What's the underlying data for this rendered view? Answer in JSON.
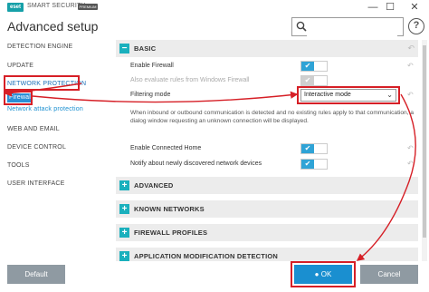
{
  "window": {
    "logo_text": "eset",
    "app_name": "SMART SECURITY",
    "app_badge": "PREMIUM",
    "minimize_glyph": "—",
    "maximize_glyph": "☐",
    "close_glyph": "✕"
  },
  "header": {
    "title": "Advanced setup",
    "search_placeholder": "",
    "help_glyph": "?"
  },
  "sidebar": {
    "items": [
      {
        "label": "DETECTION ENGINE"
      },
      {
        "label": "UPDATE"
      },
      {
        "label": "NETWORK PROTECTION"
      },
      {
        "label": "Firewall"
      },
      {
        "label": "Network attack protection"
      },
      {
        "label": "WEB AND EMAIL"
      },
      {
        "label": "DEVICE CONTROL"
      },
      {
        "label": "TOOLS"
      },
      {
        "label": "USER INTERFACE"
      }
    ]
  },
  "basic": {
    "title": "BASIC",
    "toggle_glyph": "−",
    "enable_firewall": "Enable Firewall",
    "evaluate_windows": "Also evaluate rules from Windows Firewall",
    "filtering_mode_label": "Filtering mode",
    "filtering_mode_value": "Interactive mode",
    "description": "When inbound or outbound communication is detected and no existing rules apply to that communication, a dialog window requesting an unknown connection will be displayed.",
    "enable_connected_home": "Enable Connected Home",
    "notify_new_devices": "Notify about newly discovered network devices",
    "check_glyph": "✔",
    "undo_glyph": "↶"
  },
  "sections": [
    {
      "title": "ADVANCED",
      "toggle_glyph": "+"
    },
    {
      "title": "KNOWN NETWORKS",
      "toggle_glyph": "+"
    },
    {
      "title": "FIREWALL PROFILES",
      "toggle_glyph": "+"
    },
    {
      "title": "APPLICATION MODIFICATION DETECTION",
      "toggle_glyph": "+"
    }
  ],
  "footer": {
    "default_label": "Default",
    "ok_label": "OK",
    "ok_icon": "shield-icon",
    "cancel_label": "Cancel"
  },
  "colors": {
    "accent": "#1a8fd0",
    "toggle_on": "#2fa3d6",
    "section_toggle": "#1ab0bd",
    "highlight": "#d61f26",
    "button_gray": "#8f9aa2"
  }
}
